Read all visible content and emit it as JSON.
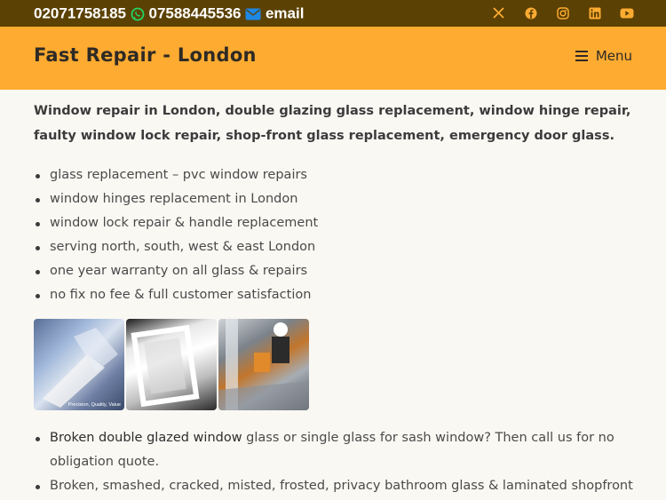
{
  "topbar": {
    "phone1": "02071758185",
    "phone2": "07588445536",
    "email_label": "email",
    "social": [
      "x-icon",
      "facebook-icon",
      "instagram-icon",
      "linkedin-icon",
      "youtube-icon"
    ]
  },
  "header": {
    "brand": "Fast Repair - London",
    "menu_label": "Menu"
  },
  "main": {
    "intro": "Window repair in London, double glazing glass replacement, window hinge repair, faulty window lock repair, shop-front glass replacement, emergency door glass.",
    "features": [
      "glass replacement – pvc window repairs",
      "window hinges replacement in London",
      "window lock repair & handle replacement",
      "serving north, south, west & east London",
      "one year warranty on all glass & repairs",
      "no fix no fee & full customer satisfaction"
    ],
    "gallery_caption": "Precision, Quality, Value",
    "services": [
      {
        "link": "Broken double glazed window",
        "text": " glass or single glass for sash window? Then call us for no obligation quote."
      },
      {
        "link": "",
        "text": "Broken, smashed, cracked, misted, frosted, privacy bathroom glass & laminated shopfront"
      }
    ]
  },
  "colors": {
    "topbar_bg": "#5b4103",
    "header_bg": "#fdab31",
    "whatsapp": "#25d366",
    "email_icon": "#1e88e5",
    "social_icon": "#fdab31"
  }
}
